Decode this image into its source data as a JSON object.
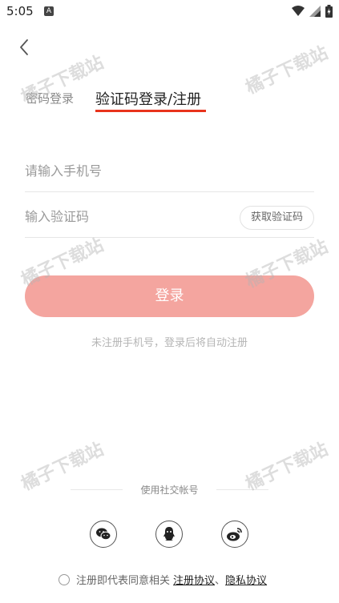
{
  "status_bar": {
    "time": "5:05",
    "notification_letter": "A"
  },
  "tabs": {
    "password_login": "密码登录",
    "code_login_register": "验证码登录/注册",
    "active_color": "#e8331c"
  },
  "form": {
    "phone_placeholder": "请输入手机号",
    "code_placeholder": "输入验证码",
    "get_code_label": "获取验证码",
    "login_label": "登录",
    "login_color": "#f4a59f",
    "hint": "未注册手机号，登录后将自动注册"
  },
  "social": {
    "label": "使用社交帐号",
    "icons": [
      "wechat-icon",
      "qq-icon",
      "weibo-icon"
    ]
  },
  "agreement": {
    "prefix": "注册即代表同意相关",
    "terms_link": "注册协议",
    "separator": "、",
    "privacy_link": "隐私协议"
  },
  "watermark": "橘子下载站"
}
